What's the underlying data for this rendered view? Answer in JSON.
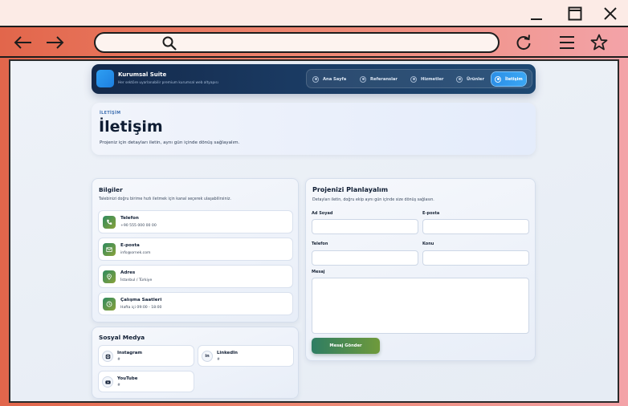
{
  "site": {
    "brand_name": "Kurumsal Suite",
    "brand_tagline": "Her sektöre uyarlanabilir premium kurumsal web altyapısı"
  },
  "nav": [
    {
      "label": "Ana Sayfa",
      "active": false
    },
    {
      "label": "Referanslar",
      "active": false
    },
    {
      "label": "Hizmetler",
      "active": false
    },
    {
      "label": "Ürünler",
      "active": false
    },
    {
      "label": "İletişim",
      "active": true
    }
  ],
  "hero": {
    "eyebrow": "İLETİŞİM",
    "title": "İletişim",
    "description": "Projeniz için detayları iletin, aynı gün içinde dönüş sağlayalım."
  },
  "info": {
    "title": "Bilgiler",
    "subtitle": "Talebinizi doğru birime hızlı iletmek için kanal seçerek ulaşabilirsiniz.",
    "items": [
      {
        "label": "Telefon",
        "value": "+90 555 000 00 00",
        "icon": "phone-icon"
      },
      {
        "label": "E-posta",
        "value": "info@ornek.com",
        "icon": "mail-icon"
      },
      {
        "label": "Adres",
        "value": "İstanbul / Türkiye",
        "icon": "location-icon"
      },
      {
        "label": "Çalışma Saatleri",
        "value": "Hafta içi 09:00 - 18:00",
        "icon": "clock-icon"
      }
    ]
  },
  "social": {
    "title": "Sosyal Medya",
    "items": [
      {
        "label": "Instagram",
        "handle": "#",
        "icon": "instagram-icon"
      },
      {
        "label": "LinkedIn",
        "handle": "#",
        "icon": "linkedin-icon",
        "glyph": "in"
      },
      {
        "label": "YouTube",
        "handle": "#",
        "icon": "youtube-icon"
      }
    ]
  },
  "form": {
    "title": "Projenizi Planlayalım",
    "subtitle": "Detayları iletin, doğru ekip aynı gün içinde size dönüş sağlasın.",
    "fields": {
      "name_label": "Ad Soyad",
      "name_value": "",
      "email_label": "E-posta",
      "email_value": "",
      "phone_label": "Telefon",
      "phone_value": "",
      "subject_label": "Konu",
      "subject_value": "",
      "message_label": "Mesaj",
      "message_value": ""
    },
    "submit_label": "Mesaj Gönder"
  },
  "colors": {
    "header_bg": "#14294a",
    "active_nav": "#2c8fe6",
    "accent_green": "#2e7d63",
    "toolbar_gradient_start": "#e2664b",
    "toolbar_gradient_end": "#f3a3a8"
  }
}
